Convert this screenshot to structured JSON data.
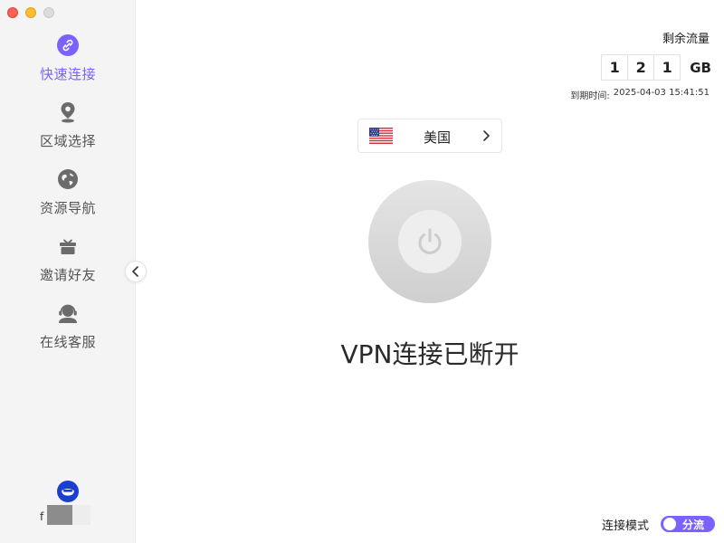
{
  "sidebar": {
    "items": [
      {
        "label": "快速连接",
        "icon": "link-icon"
      },
      {
        "label": "区域选择",
        "icon": "location-pin-icon"
      },
      {
        "label": "资源导航",
        "icon": "globe-icon"
      },
      {
        "label": "邀请好友",
        "icon": "gift-icon"
      },
      {
        "label": "在线客服",
        "icon": "headset-icon"
      }
    ],
    "active_index": 0,
    "user": {
      "name": "f"
    }
  },
  "traffic": {
    "title": "剩余流量",
    "digits": [
      "1",
      "2",
      "1"
    ],
    "unit": "GB",
    "expire_label": "到期时间:",
    "expire_value": "2025-04-03 15:41:51"
  },
  "region": {
    "name": "美国",
    "flag": "us-flag-icon"
  },
  "connection": {
    "status": "VPN连接已断开"
  },
  "mode": {
    "label": "连接模式",
    "value": "分流"
  },
  "colors": {
    "accent": "#7b61ff",
    "icon_gray": "#6b6b6b"
  }
}
